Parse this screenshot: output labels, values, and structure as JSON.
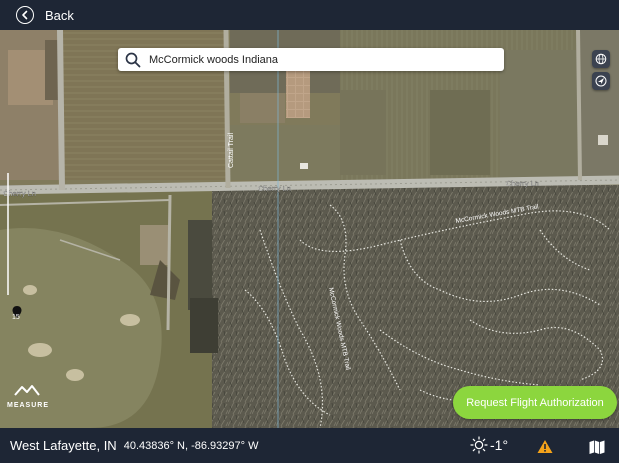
{
  "header": {
    "back_label": "Back"
  },
  "search": {
    "value": "McCormick woods Indiana"
  },
  "map": {
    "labels": {
      "cherry_ln_left": "Cherry Ln",
      "cherry_ln_center": "Cherry Ln",
      "cherry_ln_right": "Cherry Ln",
      "cattail_trail": "Cattail Trail",
      "trail_east": "McCormick Woods MTB Trail",
      "trail_south": "McCormick Woods MTB Trail"
    },
    "altitude_value": "15",
    "logo_text": "MEASURE"
  },
  "actions": {
    "request_label": "Request Flight Authorization"
  },
  "footer": {
    "location": "West Lafayette, IN",
    "coordinates": "40.43836° N, -86.93297° W",
    "temperature": "-1°"
  },
  "colors": {
    "bar": "#1e2635",
    "accent": "#8cd63e",
    "warning": "#f5a31a"
  },
  "icons": {
    "back": "back-arrow-icon",
    "search": "search-icon",
    "globe": "globe-icon",
    "locate": "locate-icon",
    "weather": "sun-icon",
    "warning": "warning-icon",
    "map": "map-icon"
  }
}
